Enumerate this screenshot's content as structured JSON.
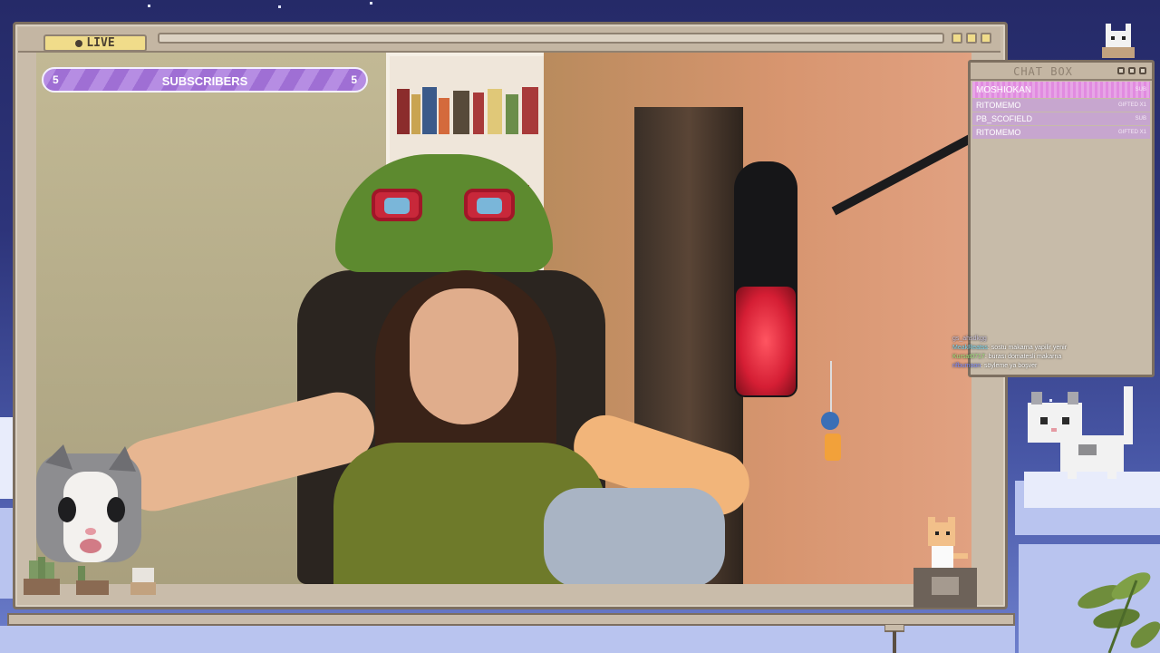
{
  "overlay": {
    "live_badge": "LIVE",
    "subscribers": {
      "label": "SUBSCRIBERS",
      "current": "5",
      "goal": "5",
      "progress": 1.0
    }
  },
  "chat_box": {
    "title": "CHAT BOX",
    "alerts": [
      {
        "user": "MOSHIOKAN",
        "tag": "SUB"
      },
      {
        "user": "RITOMEMO",
        "tag": "GIFTED X1"
      },
      {
        "user": "PB_SCOFIELD",
        "tag": "SUB"
      },
      {
        "user": "RITOMEMO",
        "tag": "GIFTED X1"
      }
    ],
    "messages": [
      {
        "user": "gs_ahsdkgg",
        "text": ""
      },
      {
        "user": "MeakReatss",
        "text": "sostu makarna yapilir yenir"
      },
      {
        "user": "Kursat0717",
        "text": "burası domatesli makarna"
      },
      {
        "user": "rifbumoon",
        "text": "söyleme ya boşver"
      }
    ]
  },
  "colors": {
    "frame": "#c9bcaa",
    "frame_border": "#7d6f60",
    "live_badge": "#f0dc8a",
    "sub_bar": "#b68de3",
    "alert": "#c7a6cf",
    "alert_highlight": "#e18be0",
    "sky": "#2d347a"
  },
  "icons": {
    "live": "live-dot-icon",
    "window_buttons": "window-control-icon",
    "kitten": "kitten-icon",
    "pixel_cat": "pixel-cat-icon",
    "plant": "plant-icon"
  }
}
